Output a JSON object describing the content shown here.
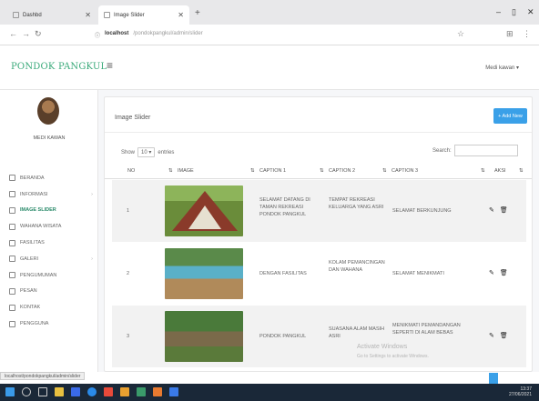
{
  "browser": {
    "tabs": [
      {
        "label": "Dashbd"
      },
      {
        "label": "Image Slider"
      }
    ],
    "url_site": "localhost",
    "url_path": "/pondokpangkul/admin/slider"
  },
  "app": {
    "brand": "PONDOK PANGKUL",
    "user_menu": "Medi kawan ▾",
    "user_name": "MEDI KAWAN"
  },
  "sidebar": {
    "items": [
      {
        "label": "BERANDA"
      },
      {
        "label": "INFORMASI"
      },
      {
        "label": "IMAGE SLIDER"
      },
      {
        "label": "WAHANA WISATA"
      },
      {
        "label": "FASILITAS"
      },
      {
        "label": "GALERI"
      },
      {
        "label": "PENGUMUMAN"
      },
      {
        "label": "PESAN"
      },
      {
        "label": "KONTAK"
      },
      {
        "label": "PENGGUNA"
      }
    ]
  },
  "main": {
    "title": "Image Slider",
    "add_button": "+ Add New",
    "show_label": "Show",
    "show_value": "10",
    "entries_label": "entries",
    "search_label": "Search:",
    "columns": [
      "NO",
      "IMAGE",
      "CAPTION 1",
      "CAPTION 2",
      "CAPTION 3",
      "AKSI"
    ],
    "rows": [
      {
        "no": "1",
        "c1": "SELAMAT DATANG DI TAMAN REKREASI PONDOK PANGKUL",
        "c2": "TEMPAT REKREASI KELUARGA YANG ASRI",
        "c3": "SELAMAT BERKUNJUNG"
      },
      {
        "no": "2",
        "c1": "DENGAN FASILITAS",
        "c2": "KOLAM PEMANCINGAN DAN WAHANA",
        "c3": "SELAMAT MENIKMATI"
      },
      {
        "no": "3",
        "c1": "PONDOK PANGKUL",
        "c2": "SUASANA ALAM MASIH ASRI",
        "c3": "MENIKMATI PEMANDANGAN SEPERTI DI ALAM BEBAS"
      }
    ]
  },
  "overlay": {
    "activate_line1": "Activate Windows",
    "activate_line2": "Go to Settings to activate Windows."
  },
  "status": {
    "hover_url": "localhost/pondokpangkul/admin/slider"
  },
  "taskbar": {
    "time": "13:37",
    "date": "27/06/2021"
  },
  "colors": {
    "brand": "#3aaa7a",
    "button": "#3aa0e8"
  }
}
